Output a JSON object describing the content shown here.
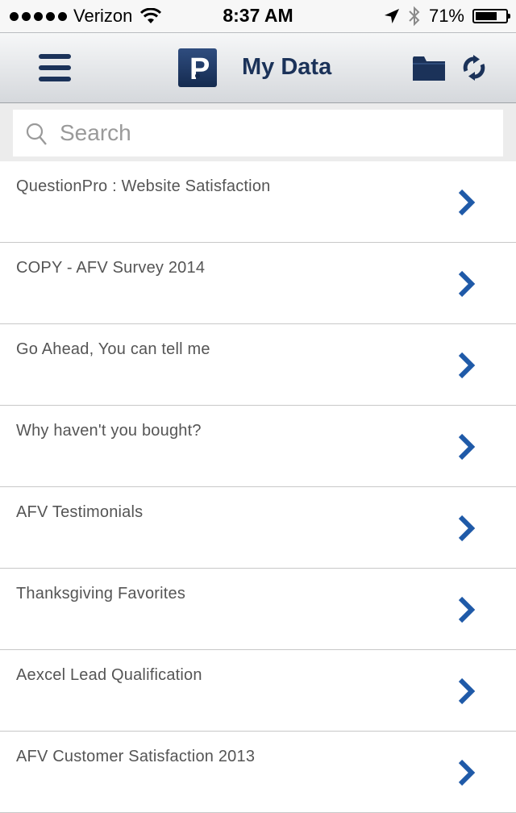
{
  "status_bar": {
    "carrier": "Verizon",
    "time": "8:37 AM",
    "battery_percent": "71%",
    "battery_level": 0.71,
    "icons": [
      "signal-dots-icon",
      "wifi-icon",
      "location-arrow-icon",
      "bluetooth-icon",
      "battery-icon"
    ]
  },
  "navbar": {
    "title": "My Data",
    "logo_letter": "P",
    "icons": [
      "menu-icon",
      "logo-icon",
      "folder-icon",
      "refresh-icon"
    ]
  },
  "search": {
    "placeholder": "Search",
    "value": ""
  },
  "list": {
    "items": [
      {
        "label": "QuestionPro : Website Satisfaction"
      },
      {
        "label": "COPY - AFV Survey 2014"
      },
      {
        "label": "Go Ahead, You can tell me"
      },
      {
        "label": "Why haven't you bought?"
      },
      {
        "label": "AFV Testimonials"
      },
      {
        "label": "Thanksgiving Favorites"
      },
      {
        "label": "Aexcel Lead Qualification"
      },
      {
        "label": "AFV Customer Satisfaction 2013"
      }
    ]
  },
  "colors": {
    "brand_navy": "#1b3259",
    "chevron_blue": "#1f5aa8",
    "row_text": "#555555"
  }
}
